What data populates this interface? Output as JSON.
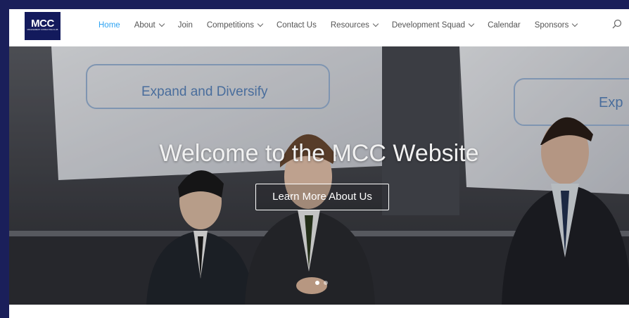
{
  "logo": {
    "text": "MCC",
    "subtitle": "MANAGEMENT CONSULTING CLUB"
  },
  "nav": {
    "items": [
      {
        "label": "Home",
        "active": true,
        "dropdown": false
      },
      {
        "label": "About",
        "active": false,
        "dropdown": true
      },
      {
        "label": "Join",
        "active": false,
        "dropdown": false
      },
      {
        "label": "Competitions",
        "active": false,
        "dropdown": true
      },
      {
        "label": "Contact Us",
        "active": false,
        "dropdown": false
      },
      {
        "label": "Resources",
        "active": false,
        "dropdown": true
      },
      {
        "label": "Development Squad",
        "active": false,
        "dropdown": true
      },
      {
        "label": "Calendar",
        "active": false,
        "dropdown": false
      },
      {
        "label": "Sponsors",
        "active": false,
        "dropdown": true
      }
    ],
    "search_icon": "search-icon"
  },
  "hero": {
    "title": "Welcome to the MCC Website",
    "button_label": "Learn More About Us",
    "slide_text_left": "Expand and Diversify",
    "slide_text_right": "Exp",
    "slides": {
      "count": 2,
      "active_index": 0
    }
  },
  "colors": {
    "accent": "#2ea3f2",
    "border": "#1a1f5a",
    "logo_bg": "#131a5c"
  }
}
